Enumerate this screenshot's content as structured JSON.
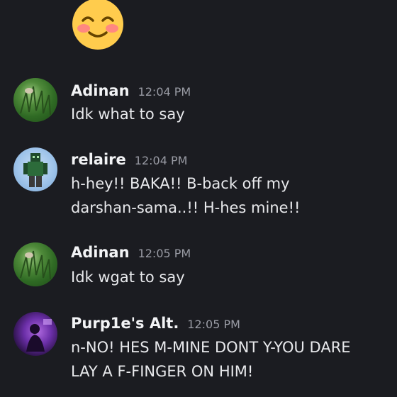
{
  "emoji": "smiling-face-with-smiling-eyes",
  "messages": [
    {
      "author": "Adinan",
      "time": "12:04 PM",
      "lines": [
        "Idk what to say"
      ],
      "avatar": "grass-avatar"
    },
    {
      "author": "relaire",
      "time": "12:04 PM",
      "lines": [
        "h-hey!! BAKA!! B-back off my",
        "darshan-sama..!! H-hes mine!!"
      ],
      "avatar": "minecraft-skin-avatar"
    },
    {
      "author": "Adinan",
      "time": "12:05 PM",
      "lines": [
        "Idk wgat to say"
      ],
      "avatar": "grass-avatar"
    },
    {
      "author": "Purp1e's Alt.",
      "time": "12:05 PM",
      "lines": [
        "n-NO! HES M-MINE DONT Y-YOU DARE",
        "LAY A F-FINGER ON HIM!"
      ],
      "avatar": "purple-figure-avatar"
    }
  ],
  "colors": {
    "background": "#1b1c21",
    "name": "#f2f3f5",
    "timestamp": "#9a9ca5",
    "text": "#e8e9ec"
  }
}
